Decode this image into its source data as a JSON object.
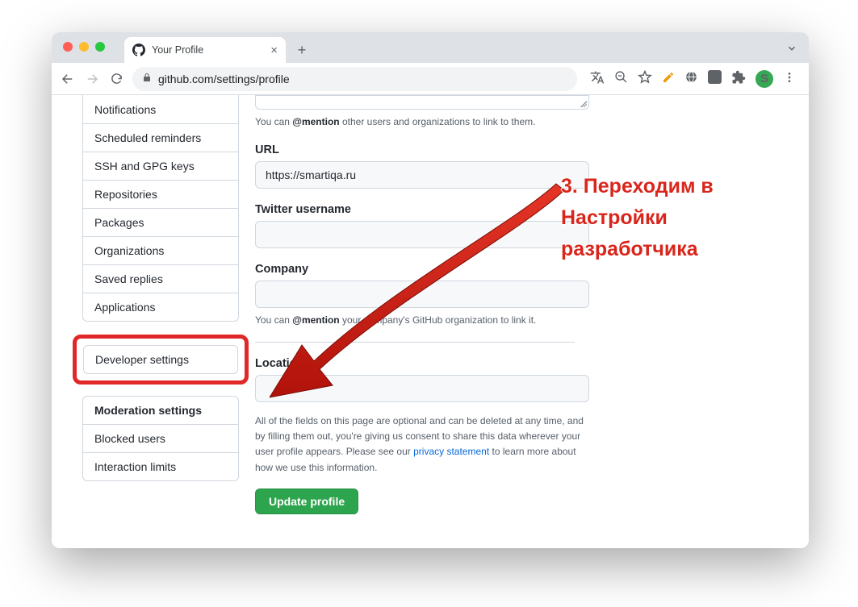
{
  "browser": {
    "tab_title": "Your Profile",
    "url_display": "github.com/settings/profile",
    "avatar_letter": "S"
  },
  "sidebar": {
    "group1": [
      "Notifications",
      "Scheduled reminders",
      "SSH and GPG keys",
      "Repositories",
      "Packages",
      "Organizations",
      "Saved replies",
      "Applications"
    ],
    "developer": "Developer settings",
    "moderation_header": "Moderation settings",
    "moderation_items": [
      "Blocked users",
      "Interaction limits"
    ]
  },
  "form": {
    "bio_hint_pre": "You can ",
    "bio_hint_strong": "@mention",
    "bio_hint_post": " other users and organizations to link to them.",
    "url_label": "URL",
    "url_value": "https://smartiqa.ru",
    "twitter_label": "Twitter username",
    "twitter_value": "",
    "company_label": "Company",
    "company_value": "",
    "company_hint_pre": "You can ",
    "company_hint_strong": "@mention",
    "company_hint_post": " your company's GitHub organization to link it.",
    "location_label": "Location",
    "location_value": "",
    "disclosure_text": "All of the fields on this page are optional and can be deleted at any time, and by filling them out, you're giving us consent to share this data wherever your user profile appears. Please see our ",
    "disclosure_link": "privacy statement",
    "disclosure_after": " to learn more about how we use this information.",
    "submit_label": "Update profile"
  },
  "annotation": {
    "text": "3. Переходим в Настройки разработчика"
  }
}
